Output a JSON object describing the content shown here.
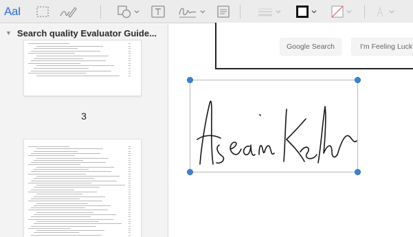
{
  "toolbar": {
    "text_tool_label": "AaI",
    "tools": [
      {
        "name": "text-style-tool",
        "icon": "text-style-icon"
      },
      {
        "name": "selection-tool",
        "icon": "rectangular-selection-icon"
      },
      {
        "name": "sketch-tool",
        "icon": "sketch-pen-icon"
      },
      {
        "name": "shapes-tool",
        "icon": "shapes-icon",
        "has_menu": true
      },
      {
        "name": "text-box-tool",
        "icon": "text-box-icon"
      },
      {
        "name": "sign-tool",
        "icon": "signature-icon",
        "has_menu": true
      },
      {
        "name": "note-tool",
        "icon": "note-icon"
      },
      {
        "name": "shape-style-tool",
        "icon": "line-style-icon",
        "has_menu": true,
        "disabled": true
      },
      {
        "name": "border-color-tool",
        "icon": "border-color-icon",
        "has_menu": true
      },
      {
        "name": "fill-color-tool",
        "icon": "fill-color-icon",
        "has_menu": true
      },
      {
        "name": "text-style-menu-tool",
        "icon": "text-color-icon",
        "has_menu": true,
        "disabled": true
      }
    ],
    "accent_color": "#2f6fd6"
  },
  "sidebar": {
    "document_title": "Search quality Evaluator Guide...",
    "pages": [
      {
        "page_number": "3"
      }
    ]
  },
  "canvas": {
    "buttons": {
      "google_search": "Google Search",
      "feeling_lucky": "I'm Feeling Luck"
    },
    "signature": {
      "selection_handle_color": "#3a82d8"
    }
  }
}
